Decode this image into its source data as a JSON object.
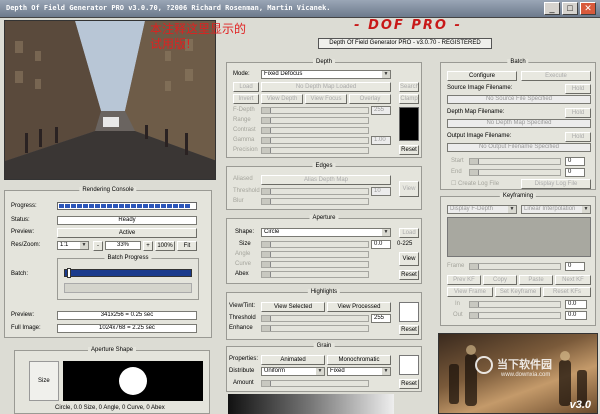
{
  "window": {
    "title": "Depth Of Field Generator PRO v3.0.70, ?2006 Richard Rosenman, Martin Vicanek."
  },
  "header": {
    "logo_text": "- DOF PRO -",
    "registered": "Depth Of Field Generator PRO - v3.0.70 - REGISTERED"
  },
  "overlay_note": "本注释这里显示的\n试用版!",
  "render_console": {
    "title": "Rendering Console",
    "progress_label": "Progress:",
    "status_label": "Status:",
    "status_value": "Ready",
    "preview_label": "Preview:",
    "preview_value": "Active",
    "res_zoom_label": "Res/Zoom:",
    "res_value": "1:1",
    "zoom_value": "33%",
    "zoom_pct": "100%",
    "fit_label": "Fit",
    "batch_progress_title": "Batch Progress",
    "batch_label": "Batch:",
    "preview_size_label": "Preview:",
    "preview_size_value": "341x256 = 0.25 sec",
    "full_image_label": "Full Image:",
    "full_image_value": "1024x768 = 2.25 sec"
  },
  "aperture_shape": {
    "title": "Aperture Shape",
    "size_label": "Size",
    "caption": "Circle, 0.0 Size, 0 Angle, 0 Curve, 0 Abex"
  },
  "depth": {
    "title": "Depth",
    "mode_label": "Mode:",
    "mode_value": "Fixed Defocus",
    "load_label": "Load",
    "no_depth_map": "No Depth Map Loaded",
    "invert_label": "Invert",
    "view_depth": "View Depth",
    "view_focus": "View Focus",
    "overlay": "Overlay",
    "fdepth_label": "F-Depth",
    "range_label": "Range",
    "contrast_label": "Contrast",
    "gamma_label": "Gamma",
    "precision_label": "Precision",
    "fdepth_value": "255",
    "gamma_value": "1.00",
    "reset_label": "Reset",
    "search_label": "Search",
    "clamp_label": "Clamp"
  },
  "edges": {
    "title": "Edges",
    "aliased_label": "Aliased",
    "alias_depth_map": "Alias Depth Map",
    "threshold_label": "Threshold",
    "blur_label": "Blur",
    "threshold_value": "10",
    "view_label": "View"
  },
  "aperture": {
    "title": "Aperture",
    "shape_label": "Shape:",
    "shape_value": "Circle",
    "load_label": "Load",
    "size_label": "Size",
    "size_value": "0.0",
    "range_value": "0-225",
    "angle_label": "Angle",
    "curve_label": "Curve",
    "abex_label": "Abex",
    "view_label": "View",
    "reset_label": "Reset"
  },
  "highlights": {
    "title": "Highlights",
    "view_tint_label": "View/Tint:",
    "view_selected": "View Selected",
    "view_processed": "View Processed",
    "threshold_label": "Threshold",
    "threshold_value": "255",
    "enhance_label": "Enhance",
    "reset_label": "Reset"
  },
  "grain": {
    "title": "Grain",
    "properties_label": "Properties:",
    "animated": "Animated",
    "monochromatic": "Monochromatic",
    "distribute_label": "Distribute",
    "distribute_value": "Uniform",
    "fixed_value": "Fixed",
    "amount_label": "Amount",
    "reset_label": "Reset"
  },
  "batch": {
    "title": "Batch",
    "configure": "Configure",
    "execute": "Execute",
    "source_label": "Source Image Filename:",
    "hold_label": "Hold",
    "no_source": "No Source File Specified",
    "depth_map_label": "Depth Map Filename:",
    "no_depth_file": "No Depth Map Specified",
    "output_label": "Output Image Filename:",
    "no_output": "No Output Filename Specified",
    "start_label": "Start",
    "end_label": "End",
    "start_value": "0",
    "end_value": "0",
    "create_log": "Create Log File",
    "display_log": "Display Log File"
  },
  "keyframing": {
    "title": "Keyframing",
    "param_value": "Display F-Depth",
    "interp_value": "Linear Interpolation",
    "frame_label": "Frame",
    "frame_value": "0",
    "prev_kf": "Prev KF",
    "copy": "Copy",
    "paste": "Paste",
    "next_kf": "Next KF",
    "view_frame": "View Frame",
    "set_keyframe": "Set Keyframe",
    "reset_kfs": "Reset KFs",
    "in_label": "In",
    "out_label": "Out",
    "in_value": "0.0",
    "out_value": "0.0"
  },
  "watermark": {
    "site": "当下软件园",
    "url": "www.downxia.com",
    "version_mark": "v3.0"
  }
}
